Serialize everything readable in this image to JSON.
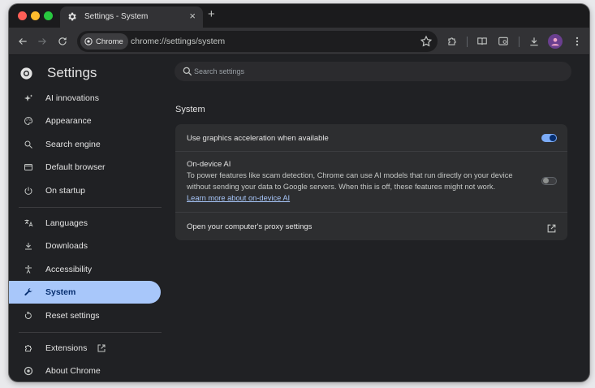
{
  "tab": {
    "title": "Settings - System",
    "close": "×",
    "new_tab": "+"
  },
  "toolbar": {
    "chip_label": "Chrome",
    "url": "chrome://settings/system"
  },
  "sidebar": {
    "title": "Settings",
    "items": [
      {
        "label": "AI innovations",
        "icon": "sparkle-icon"
      },
      {
        "label": "Appearance",
        "icon": "palette-icon"
      },
      {
        "label": "Search engine",
        "icon": "search-icon"
      },
      {
        "label": "Default browser",
        "icon": "browser-window-icon"
      },
      {
        "label": "On startup",
        "icon": "power-icon"
      },
      {
        "label": "Languages",
        "icon": "translate-icon"
      },
      {
        "label": "Downloads",
        "icon": "download-icon"
      },
      {
        "label": "Accessibility",
        "icon": "accessibility-icon"
      },
      {
        "label": "System",
        "icon": "wrench-icon",
        "active": true
      },
      {
        "label": "Reset settings",
        "icon": "reset-icon"
      },
      {
        "label": "Extensions",
        "icon": "puzzle-icon"
      },
      {
        "label": "About Chrome",
        "icon": "chrome-icon"
      }
    ]
  },
  "search": {
    "placeholder": "Search settings"
  },
  "main": {
    "section_title": "System",
    "rows": {
      "graphics": {
        "title": "Use graphics acceleration when available",
        "enabled": true
      },
      "ondevice": {
        "title": "On-device AI",
        "desc_line1": "To power features like scam detection, Chrome can use AI models that run directly on your device",
        "desc_line2": "without sending your data to Google servers. When this is off, these features might not work.",
        "link": "Learn more about on-device AI",
        "enabled": false
      },
      "proxy": {
        "title": "Open your computer's proxy settings"
      }
    }
  },
  "colors": {
    "accent": "#a8c7fa",
    "toggle_on": "#7cacf8",
    "background": "#202124",
    "card": "#2d2e30"
  }
}
